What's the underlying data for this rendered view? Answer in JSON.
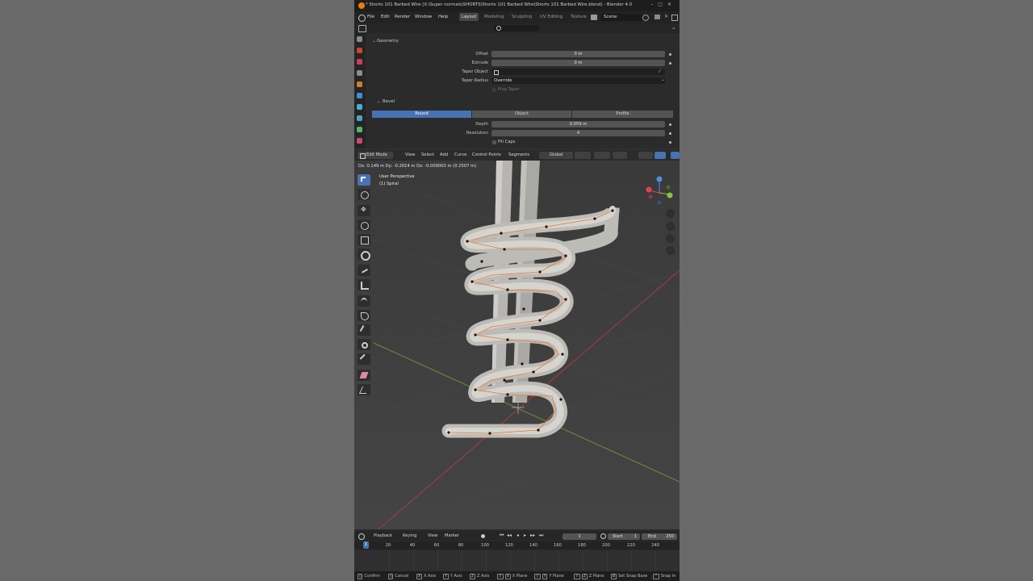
{
  "window": {
    "title": "* Shorts 101 Barbed Wire [X:\\Super normals\\SHORTS\\Shorts 101 Barbed Wire\\Shorts 101 Barbed Wire.blend] - Blender 4.0"
  },
  "menubar": {
    "menus": [
      "File",
      "Edit",
      "Render",
      "Window",
      "Help"
    ],
    "workspaces": [
      "Layout",
      "Modeling",
      "Sculpting",
      "UV Editing",
      "Texture"
    ],
    "active_workspace": "Layout",
    "scene": "Scene"
  },
  "properties": {
    "geometry_panel": "Geometry",
    "offset": {
      "label": "Offset",
      "value": "0 m"
    },
    "extrude": {
      "label": "Extrude",
      "value": "0 m"
    },
    "taper_object": {
      "label": "Taper Object",
      "value": ""
    },
    "taper_radius": {
      "label": "Taper Radius",
      "value": "Override"
    },
    "map_taper": "Map Taper",
    "bevel_panel": "Bevel",
    "bevel_modes": [
      "Round",
      "Object",
      "Profile"
    ],
    "active_bevel_mode": "Round",
    "depth": {
      "label": "Depth",
      "value": "0.059 m"
    },
    "resolution": {
      "label": "Resolution",
      "value": "4"
    },
    "fill_caps": "Fill Caps"
  },
  "viewport": {
    "mode": "Edit Mode",
    "menus": [
      "View",
      "Select",
      "Add",
      "Curve",
      "Control Points",
      "Segments"
    ],
    "transform_orientation": "Global",
    "readout": "Dx: 0.149 m   Dy: -0.2014 m   Dz: -0.009003 m (0.2507 m)",
    "view_name": "User Perspective",
    "object_name": "(1) Spiral",
    "gizmo_axes": {
      "x": "#e2424f",
      "y": "#8ac43f",
      "z": "#4f8fe0"
    },
    "selection_color": "#e8792f"
  },
  "timeline": {
    "menus": [
      "Playback",
      "Keying",
      "View",
      "Marker"
    ],
    "current_frame": "1",
    "start_label": "Start",
    "start": "1",
    "end_label": "End",
    "end": "250",
    "ticks": [
      "1",
      "20",
      "40",
      "60",
      "80",
      "100",
      "120",
      "140",
      "160",
      "180",
      "200",
      "220",
      "240"
    ]
  },
  "statusbar": {
    "items": [
      {
        "key": "",
        "label": "Confirm"
      },
      {
        "key": "",
        "label": "Cancel"
      },
      {
        "key": "X",
        "label": "X Axis"
      },
      {
        "key": "Y",
        "label": "Y Axis"
      },
      {
        "key": "Z",
        "label": "Z Axis"
      },
      {
        "key": "X",
        "label": "X Plane"
      },
      {
        "key": "Y",
        "label": "Y Plane"
      },
      {
        "key": "Z",
        "label": "Z Plane"
      },
      {
        "key": "B",
        "label": "Set Snap Base"
      },
      {
        "key": "",
        "label": "Snap In"
      }
    ]
  }
}
